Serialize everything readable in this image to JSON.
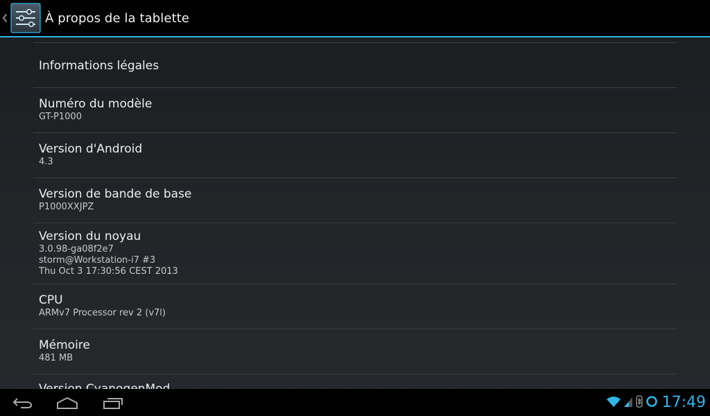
{
  "action_bar": {
    "title": "À propos de la tablette",
    "up_icon": "chevron-left-icon",
    "app_icon": "settings-sliders-icon"
  },
  "preferences": [
    {
      "title": "Informations légales",
      "summary": []
    },
    {
      "title": "Numéro du modèle",
      "summary": [
        "GT-P1000"
      ]
    },
    {
      "title": "Version d'Android",
      "summary": [
        "4.3"
      ]
    },
    {
      "title": "Version de bande de base",
      "summary": [
        "P1000XXJPZ"
      ]
    },
    {
      "title": "Version du noyau",
      "summary": [
        "3.0.98-ga08f2e7",
        "storm@Workstation-i7 #3",
        "Thu Oct 3 17:30:56 CEST 2013"
      ]
    },
    {
      "title": "CPU",
      "summary": [
        "ARMv7 Processor rev 2 (v7l)"
      ]
    },
    {
      "title": "Mémoire",
      "summary": [
        "481 MB"
      ]
    },
    {
      "title": "Version CyanogenMod",
      "summary": []
    }
  ],
  "nav_bar": {
    "back_icon": "back-icon",
    "home_icon": "home-icon",
    "recents_icon": "recent-apps-icon"
  },
  "status": {
    "time": "17:49",
    "icons": [
      "wifi-icon",
      "signal-icon",
      "bluetooth-icon",
      "sync-icon"
    ]
  },
  "colors": {
    "accent": "#33b5e5",
    "background": "#222629",
    "divider": "#3a3e41"
  }
}
